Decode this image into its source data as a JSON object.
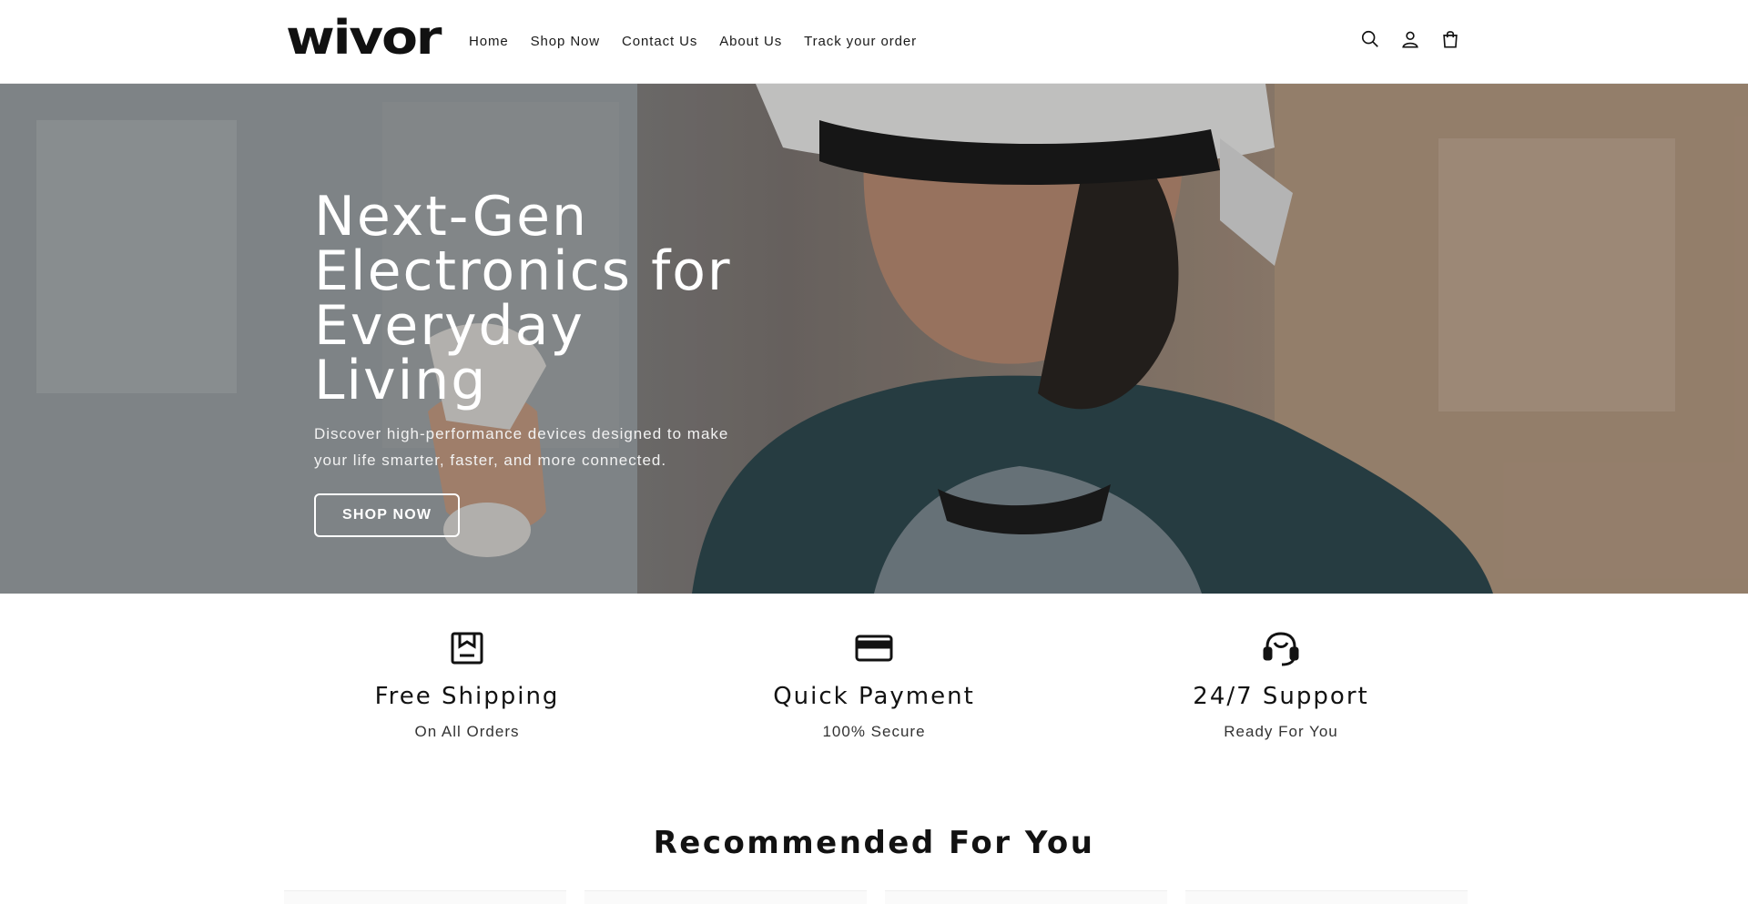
{
  "header": {
    "logo": "wivor",
    "nav": [
      "Home",
      "Shop Now",
      "Contact Us",
      "About Us",
      "Track your order"
    ],
    "icons": [
      "search-icon",
      "account-icon",
      "cart-icon"
    ]
  },
  "hero": {
    "title_line1": "Next-Gen",
    "title_line2": "Electronics for",
    "title_line3": "Everyday Living",
    "subtitle": "Discover high-performance devices designed to make your life smarter, faster, and more connected.",
    "button": "SHOP NOW"
  },
  "features": [
    {
      "icon": "shipping-box-icon",
      "title": "Free Shipping",
      "subtitle": "On All Orders"
    },
    {
      "icon": "credit-card-icon",
      "title": "Quick Payment",
      "subtitle": "100% Secure"
    },
    {
      "icon": "headset-support-icon",
      "title": "24/7 Support",
      "subtitle": "Ready For You"
    }
  ],
  "recommended": {
    "title": "Recommended For You"
  },
  "colors": {
    "text": "#121212",
    "background": "#ffffff",
    "hero_button_border": "#ffffff"
  }
}
